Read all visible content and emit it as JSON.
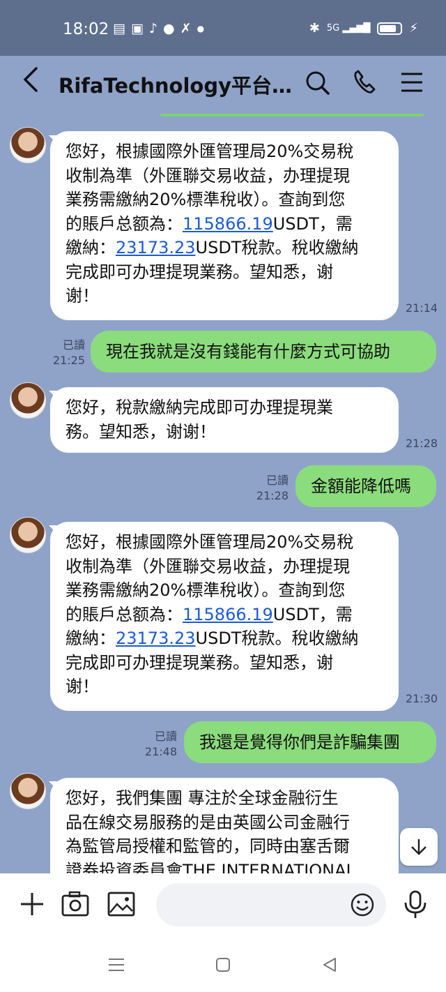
{
  "status": {
    "time": "18:02",
    "icons": [
      "message-icon",
      "shop-icon",
      "tiktok-icon",
      "chat-icon",
      "x-icon",
      "dot-icon"
    ],
    "right_icons": [
      "bluetooth-icon",
      "5g-signal-icon",
      "battery-icon"
    ],
    "network_label": "5G"
  },
  "header": {
    "title": "RifaTechnology平台…"
  },
  "messages": [
    {
      "dir": "in",
      "lines": [
        "您好，根據國際外匯管理局20%交易稅",
        "收制為準（外匯聯交易收益，办理提現",
        "業務需繳納20%標準稅收）。查詢到您",
        "的賬戶总额為："
      ],
      "line4_link": "115866.19",
      "line4_after": "USDT，需",
      "line5_before": "繳納：",
      "line5_link": "23173.23",
      "line5_after": "USDT稅款。稅收繳納",
      "lines_end": [
        "完成即可办理提現業務。望知悉，谢",
        "谢！"
      ],
      "time": "21:14"
    },
    {
      "dir": "out",
      "text": "現在我就是沒有錢能有什麼方式可協助",
      "read": "已讀",
      "time": "21:25"
    },
    {
      "dir": "in",
      "lines": [
        "您好，稅款繳納完成即可办理提現業",
        "務。望知悉，谢谢！"
      ],
      "time": "21:28"
    },
    {
      "dir": "out",
      "text": "金額能降低嗎",
      "read": "已讀",
      "time": "21:28"
    },
    {
      "dir": "in",
      "lines": [
        "您好，根據國際外匯管理局20%交易稅",
        "收制為準（外匯聯交易收益，办理提現",
        "業務需繳納20%標準稅收）。查詢到您",
        "的賬戶总额為："
      ],
      "line4_link": "115866.19",
      "line4_after": "USDT，需",
      "line5_before": "繳納：",
      "line5_link": "23173.23",
      "line5_after": "USDT稅款。稅收繳納",
      "lines_end": [
        "完成即可办理提現業務。望知悉，谢",
        "谢！"
      ],
      "time": "21:30"
    },
    {
      "dir": "out",
      "text": "我還是覺得你們是詐騙集團",
      "read": "已讀",
      "time": "21:48"
    },
    {
      "dir": "in",
      "lines": [
        "您好，我們集團 專注於全球金融衍生",
        "品在線交易服務的是由英國公司金融行",
        "為監管局授權和監管的，同時由塞舌爾",
        "證券投資委員會THE INTERNATIONAL"
      ]
    }
  ],
  "input": {
    "placeholder": ""
  },
  "colors": {
    "chat_bg": "#8fa3c9",
    "out_bubble": "#8bdc7c",
    "in_bubble": "#ffffff",
    "link": "#1a5bd8"
  }
}
